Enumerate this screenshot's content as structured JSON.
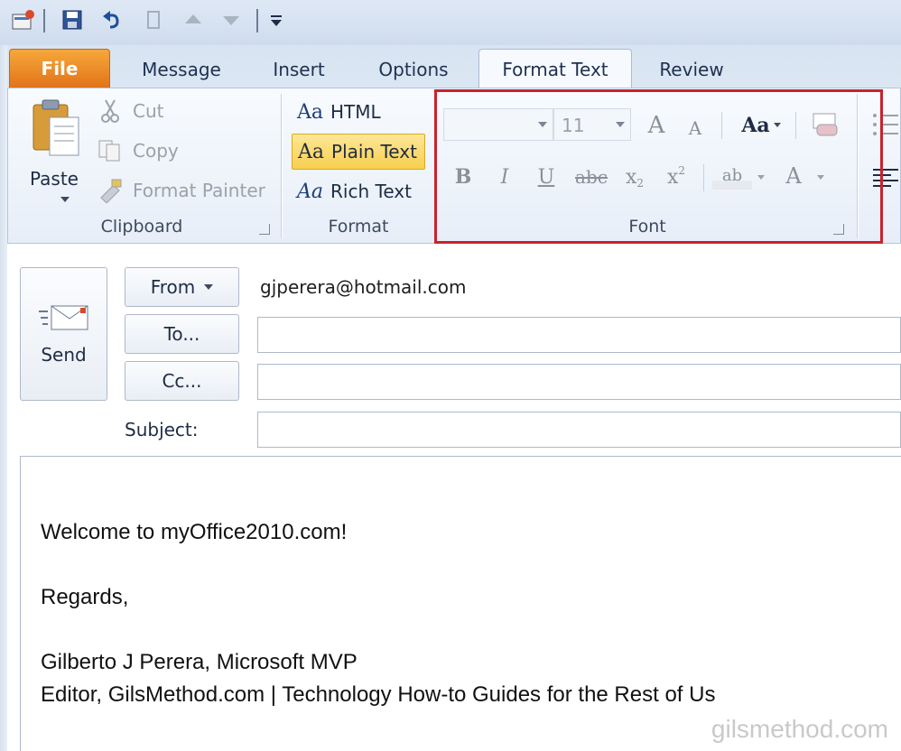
{
  "tabs": [
    "File",
    "Message",
    "Insert",
    "Options",
    "Format Text",
    "Review"
  ],
  "clipboard": {
    "paste_label": "Paste",
    "cut_label": "Cut",
    "copy_label": "Copy",
    "format_painter_label": "Format Painter",
    "group_label": "Clipboard"
  },
  "format": {
    "html_label": "HTML",
    "plain_text_label": "Plain Text",
    "rich_text_label": "Rich Text",
    "icon_text": "Aa",
    "group_label": "Format"
  },
  "font": {
    "font_name_value": "",
    "font_size_value": "11",
    "grow_icon": "A",
    "shrink_icon": "A",
    "change_case_icon": "Aa",
    "bold_icon": "B",
    "italic_icon": "I",
    "underline_icon": "U",
    "strike_icon": "abc",
    "subscript_icon": "x",
    "superscript_icon": "x",
    "highlight_icon": "ab",
    "font_color_icon": "A",
    "group_label": "Font",
    "highlight_color": "#c8232c"
  },
  "header": {
    "send_label": "Send",
    "from_label": "From",
    "from_value": "gjperera@hotmail.com",
    "to_label": "To...",
    "cc_label": "Cc...",
    "subject_label": "Subject:"
  },
  "body": {
    "line1": "Welcome to myOffice2010.com!",
    "line2": "Regards,",
    "line3": "Gilberto J Perera, Microsoft MVP",
    "line4": "Editor, GilsMethod.com | Technology How-to Guides for the Rest of Us"
  },
  "watermark": "gilsmethod.com"
}
